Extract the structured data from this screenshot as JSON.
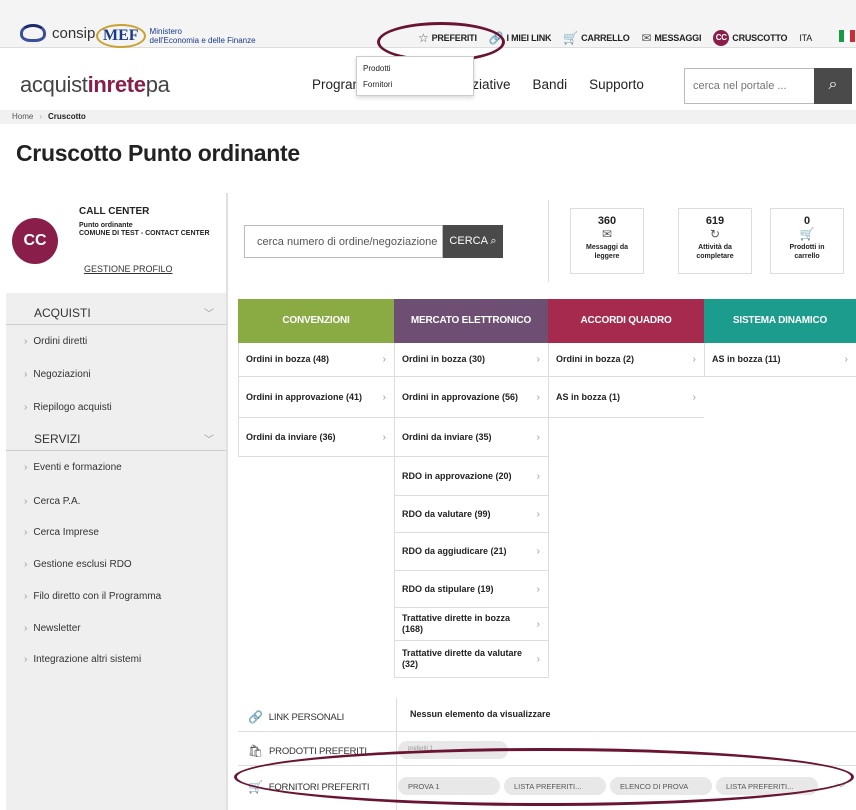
{
  "topbar": {
    "consip": "consip",
    "mef_badge": "MEF",
    "mef_text_1": "Ministero",
    "mef_text_2": "dell'Economia e delle Finanze",
    "nav": [
      {
        "label": "PREFERITI",
        "icon": "star-icon",
        "glyph": "☆"
      },
      {
        "label": "I MIEI LINK",
        "icon": "link-icon",
        "glyph": "🔗"
      },
      {
        "label": "CARRELLO",
        "icon": "cart-icon",
        "glyph": "🛒"
      },
      {
        "label": "MESSAGGI",
        "icon": "mail-icon",
        "glyph": "✉"
      }
    ],
    "user_badge": "CC",
    "cruscotto": "CRUSCOTTO",
    "lang": "ITA",
    "dropdown": [
      "Prodotti",
      "Fornitori"
    ]
  },
  "header": {
    "brand_a": "acquist",
    "brand_b": "inrete",
    "brand_c": "pa",
    "nav": [
      "Program",
      "niziative",
      "Bandi",
      "Supporto"
    ],
    "search_placeholder": "cerca nel portale ..."
  },
  "breadcrumb": {
    "home": "Home",
    "sep": "›",
    "current": "Cruscotto"
  },
  "page_title": "Cruscotto Punto ordinante",
  "profile": {
    "avatar": "CC",
    "name": "CALL CENTER",
    "role_1": "Punto ordinante",
    "role_2": "COMUNE DI TEST - CONTACT CENTER",
    "manage": "GESTIONE PROFILO"
  },
  "sidebar": {
    "acquisti": "ACQUISTI",
    "acquisti_items": [
      "Ordini diretti",
      "Negoziazioni",
      "Riepilogo acquisti"
    ],
    "servizi": "SERVIZI",
    "servizi_items": [
      "Eventi e formazione",
      "Cerca P.A.",
      "Cerca Imprese",
      "Gestione esclusi RDO",
      "Filo diretto con il Programma",
      "Newsletter",
      "Integrazione altri sistemi"
    ]
  },
  "order_search": {
    "placeholder": "cerca numero di ordine/negoziazione",
    "button": "CERCA"
  },
  "stats": [
    {
      "value": "360",
      "label_1": "Messaggi da",
      "label_2": "leggere",
      "icon": "mail-icon",
      "glyph": "✉"
    },
    {
      "value": "619",
      "label_1": "Attività da",
      "label_2": "completare",
      "icon": "refresh-icon",
      "glyph": "↻"
    },
    {
      "value": "0",
      "label_1": "Prodotti in",
      "label_2": "carrello",
      "icon": "cart-icon",
      "glyph": "🛒"
    }
  ],
  "columns": [
    {
      "title": "CONVENZIONI",
      "color": "#8aab44",
      "items": [
        "Ordini in bozza (48)",
        "Ordini in approvazione (41)",
        "Ordini da inviare (36)"
      ]
    },
    {
      "title": "MERCATO ELETTRONICO",
      "color": "#6e4e72",
      "items": [
        "Ordini in bozza (30)",
        "Ordini in approvazione (56)",
        "Ordini da inviare (35)",
        "RDO in approvazione (20)",
        "RDO da valutare (99)",
        "RDO da aggiudicare (21)",
        "RDO da stipulare (19)",
        "Trattative dirette in bozza (168)",
        "Trattative dirette da valutare (32)"
      ]
    },
    {
      "title": "ACCORDI QUADRO",
      "color": "#a52a4e",
      "items": [
        "Ordini in bozza (2)",
        "AS in bozza (1)"
      ]
    },
    {
      "title": "SISTEMA DINAMICO",
      "color": "#1b9c8c",
      "items": [
        "AS in bozza (11)"
      ]
    }
  ],
  "bottom": {
    "link_label": "LINK PERSONALI",
    "link_value": "Nessun elemento da visualizzare",
    "prod_label": "PRODOTTI PREFERITI",
    "prod_chip": "preferiti 1",
    "forn_label": "FORNITORI PREFERITI",
    "forn_chips": [
      "PROVA 1",
      "LISTA PREFERITI...",
      "ELENCO DI PROVA",
      "LISTA PREFERITI..."
    ]
  },
  "annotation_color": "#6a1434"
}
